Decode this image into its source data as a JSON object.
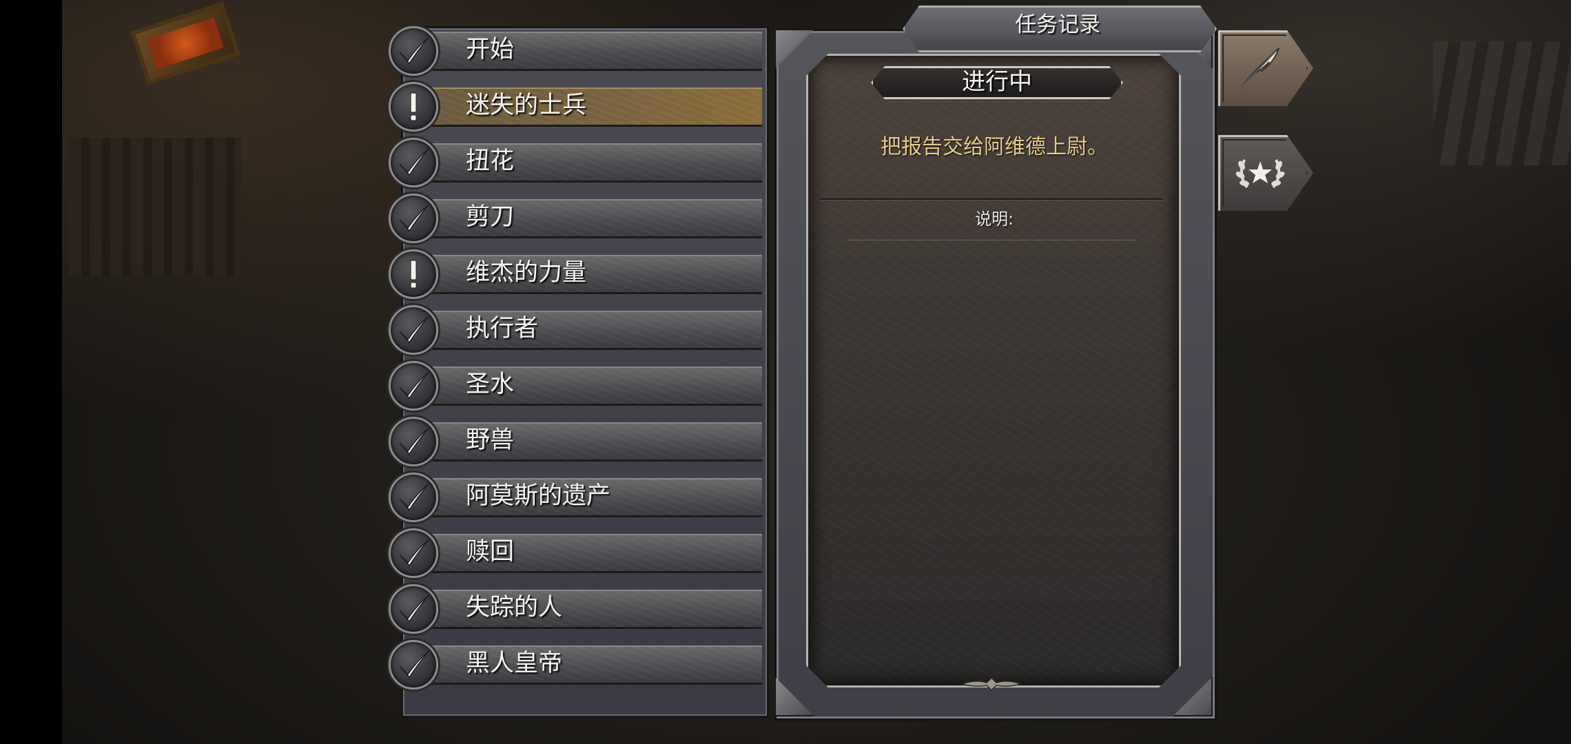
{
  "panel": {
    "title": "任务记录",
    "status": "进行中",
    "objective": "把报告交给阿维德上尉。",
    "description_label": "说明:"
  },
  "quests": [
    {
      "title": "开始",
      "state": "completed-icon"
    },
    {
      "title": "迷失的士兵",
      "state": "active-icon",
      "selected": true
    },
    {
      "title": "扭花",
      "state": "completed-icon"
    },
    {
      "title": "剪刀",
      "state": "completed-icon"
    },
    {
      "title": "维杰的力量",
      "state": "active-icon"
    },
    {
      "title": "执行者",
      "state": "completed-icon"
    },
    {
      "title": "圣水",
      "state": "completed-icon"
    },
    {
      "title": "野兽",
      "state": "completed-icon"
    },
    {
      "title": "阿莫斯的遗产",
      "state": "completed-icon"
    },
    {
      "title": "赎回",
      "state": "completed-icon"
    },
    {
      "title": "失踪的人",
      "state": "completed-icon"
    },
    {
      "title": "黑人皇帝",
      "state": "completed-icon"
    }
  ],
  "tabs": [
    {
      "icon": "quill-icon",
      "active": true
    },
    {
      "icon": "laurel-star-icon",
      "active": false
    }
  ],
  "colors": {
    "objective_text": "#e8c98c",
    "selected_row": "#7a6440",
    "frame_metal": "#4e4c50"
  }
}
